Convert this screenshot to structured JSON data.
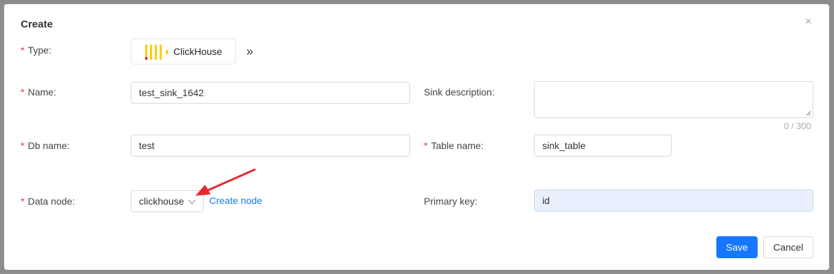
{
  "dialog": {
    "title": "Create",
    "close_glyph": "×"
  },
  "form": {
    "type": {
      "label": "Type:",
      "required": "*",
      "value": "ClickHouse",
      "switch_glyph": "»"
    },
    "name": {
      "label": "Name:",
      "required": "*",
      "value": "test_sink_1642"
    },
    "sink_description": {
      "label": "Sink description:",
      "value": "",
      "counter": "0 / 300"
    },
    "db_name": {
      "label": "Db name:",
      "required": "*",
      "value": "test"
    },
    "table_name": {
      "label": "Table name:",
      "required": "*",
      "value": "sink_table"
    },
    "data_node": {
      "label": "Data node:",
      "required": "*",
      "value": "clickhouse",
      "create_link": "Create node"
    },
    "primary_key": {
      "label": "Primary key:",
      "value": "id"
    }
  },
  "footer": {
    "save_label": "Save",
    "cancel_label": "Cancel"
  },
  "colors": {
    "primary": "#1677ff",
    "required": "#f5222d",
    "annotation_arrow": "#e8262d",
    "clickhouse_yellow": "#ffcc01",
    "clickhouse_red": "#e02020"
  },
  "icons": {
    "close": "close-icon",
    "type_switch": "double-chevron-right-icon",
    "select_arrow": "chevron-down-icon",
    "logo": "clickhouse-logo-icon"
  }
}
